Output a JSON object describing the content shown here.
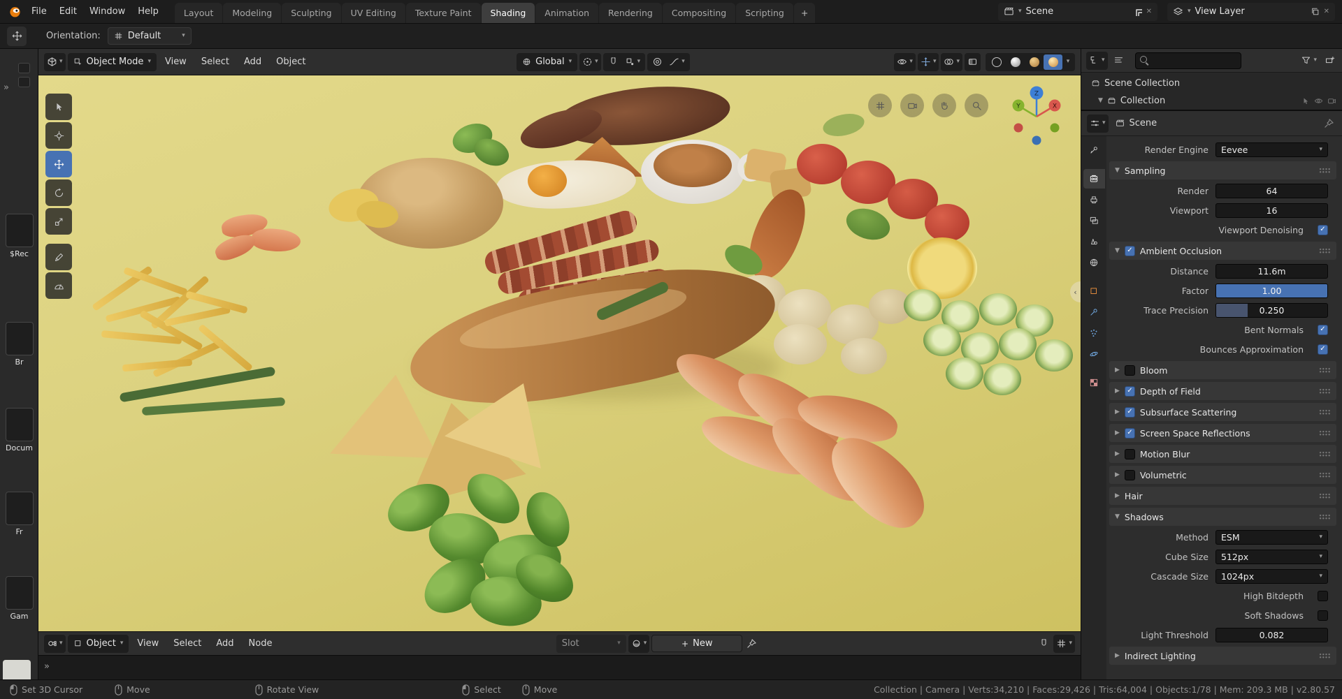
{
  "colors": {
    "accent": "#4772b3",
    "vp_top": "#e3d98a",
    "vp_bottom": "#cec161"
  },
  "icons": {
    "chevron_down": "▾",
    "tri_open": "▼",
    "tri_closed": "▶",
    "check": "✓",
    "close": "✕",
    "plus": "+",
    "expand_right": "»",
    "collapse_left": "‹"
  },
  "topbar": {
    "menus": [
      "File",
      "Edit",
      "Window",
      "Help"
    ],
    "tabs": [
      "Layout",
      "Modeling",
      "Sculpting",
      "UV Editing",
      "Texture Paint",
      "Shading",
      "Animation",
      "Rendering",
      "Compositing",
      "Scripting"
    ],
    "active_tab": "Shading",
    "scene_selector": {
      "label": "Scene"
    },
    "view_layer_selector": {
      "label": "View Layer"
    }
  },
  "tool_settings": {
    "orientation_label": "Orientation:",
    "orientation_value": "Default"
  },
  "viewport": {
    "mode": "Object Mode",
    "menus": [
      "View",
      "Select",
      "Add",
      "Object"
    ],
    "orientation": "Global",
    "axis_labels": {
      "x": "X",
      "y": "Y",
      "z": "Z"
    }
  },
  "file_browser": {
    "items": [
      "$Rec",
      "Br",
      "Docum",
      "Fr",
      "Gam"
    ]
  },
  "shader_editor": {
    "shader_type": "Object",
    "menus": [
      "View",
      "Select",
      "Add",
      "Node"
    ],
    "slot_label": "Slot",
    "new_button": "New"
  },
  "outliner": {
    "search_placeholder": "",
    "rows": [
      {
        "label": "Scene Collection"
      },
      {
        "label": "Collection"
      }
    ]
  },
  "properties": {
    "tabs": [
      "tool",
      "render",
      "output",
      "view-layer",
      "scene",
      "world",
      "object",
      "modifiers",
      "particles",
      "physics",
      "texture"
    ],
    "active_tab": "render",
    "context_label": "Scene",
    "render_engine": {
      "label": "Render Engine",
      "value": "Eevee"
    },
    "sampling": {
      "title": "Sampling",
      "render": {
        "label": "Render",
        "value": "64"
      },
      "viewport": {
        "label": "Viewport",
        "value": "16"
      },
      "denoising": {
        "label": "Viewport Denoising",
        "checked": true
      }
    },
    "ambient_occlusion": {
      "title": "Ambient Occlusion",
      "checked": true,
      "distance": {
        "label": "Distance",
        "value": "11.6m"
      },
      "factor": {
        "label": "Factor",
        "value": "1.00",
        "fill": "100%"
      },
      "trace_precision": {
        "label": "Trace Precision",
        "value": "0.250",
        "fill": "28%"
      },
      "bent_normals": {
        "label": "Bent Normals",
        "checked": true
      },
      "bounces": {
        "label": "Bounces Approximation",
        "checked": true
      }
    },
    "panels": [
      {
        "title": "Bloom",
        "checked": false
      },
      {
        "title": "Depth of Field",
        "checked": true
      },
      {
        "title": "Subsurface Scattering",
        "checked": true
      },
      {
        "title": "Screen Space Reflections",
        "checked": true
      },
      {
        "title": "Motion Blur",
        "checked": false
      },
      {
        "title": "Volumetric",
        "checked": false
      }
    ],
    "hair": {
      "title": "Hair"
    },
    "shadows": {
      "title": "Shadows",
      "method": {
        "label": "Method",
        "value": "ESM"
      },
      "cube_size": {
        "label": "Cube Size",
        "value": "512px"
      },
      "cascade_size": {
        "label": "Cascade Size",
        "value": "1024px"
      },
      "high_bitdepth": {
        "label": "High Bitdepth",
        "checked": false
      },
      "soft_shadows": {
        "label": "Soft Shadows",
        "checked": false
      },
      "light_threshold": {
        "label": "Light Threshold",
        "value": "0.082"
      }
    },
    "indirect_lighting": {
      "title": "Indirect Lighting"
    }
  },
  "status_bar": {
    "hints": [
      "Set 3D Cursor",
      "Move",
      "Rotate View",
      "Select",
      "Move"
    ],
    "stats": "Collection | Camera | Verts:34,210 | Faces:29,426 | Tris:64,004 | Objects:1/78 | Mem: 209.3 MB | v2.80.57"
  }
}
